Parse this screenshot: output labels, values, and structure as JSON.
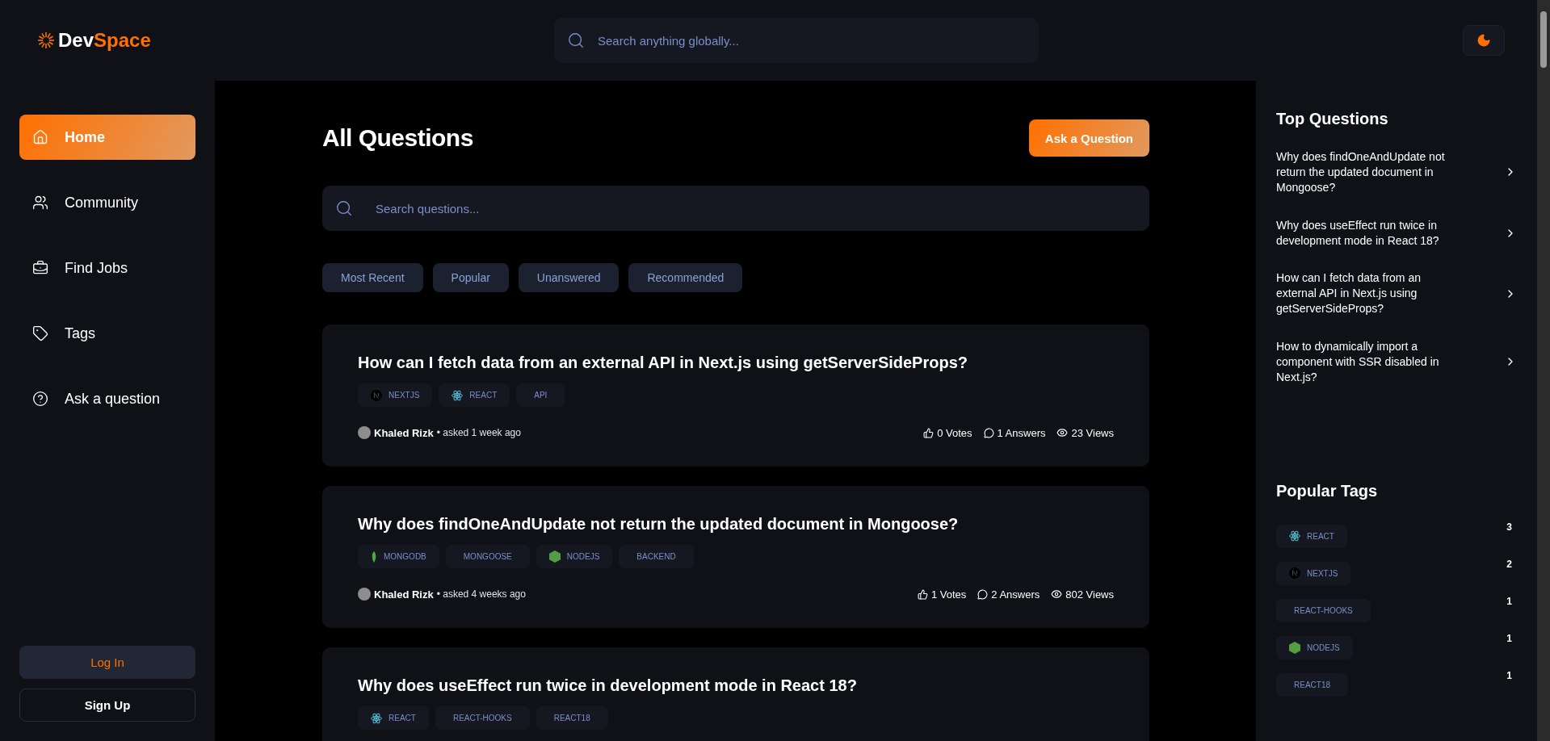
{
  "logo": {
    "part_1": "Dev",
    "part_2": "Space"
  },
  "global_search": {
    "placeholder": "Search anything globally..."
  },
  "sidebar": {
    "items": [
      {
        "label": "Home",
        "selected": true
      },
      {
        "label": "Community",
        "selected": false
      },
      {
        "label": "Find Jobs",
        "selected": false
      },
      {
        "label": "Tags",
        "selected": false
      },
      {
        "label": "Ask a question",
        "selected": false
      }
    ],
    "login": "Log In",
    "signup": "Sign Up"
  },
  "main": {
    "title": "All Questions",
    "ask_button": "Ask a Question",
    "search": {
      "placeholder": "Search questions..."
    },
    "filters": [
      {
        "label": "Most Recent",
        "selected": false
      },
      {
        "label": "Popular",
        "selected": false
      },
      {
        "label": "Unanswered",
        "selected": false
      },
      {
        "label": "Recommended",
        "selected": false
      }
    ],
    "questions": [
      {
        "title": "How can I fetch data from an external API in Next.js using getServerSideProps?",
        "tags": [
          {
            "label": "NEXTJS",
            "kind": "nextjs"
          },
          {
            "label": "REACT",
            "kind": "react"
          },
          {
            "label": "API",
            "kind": "plain"
          }
        ],
        "author": "Khaled Rizk",
        "asked": "• asked 1 week ago",
        "votes": "0 Votes",
        "answers": "1 Answers",
        "views": "23 Views"
      },
      {
        "title": "Why does findOneAndUpdate not return the updated document in Mongoose?",
        "tags": [
          {
            "label": "MONGODB",
            "kind": "leaf"
          },
          {
            "label": "MONGOOSE",
            "kind": "plain"
          },
          {
            "label": "NODEJS",
            "kind": "hex"
          },
          {
            "label": "BACKEND",
            "kind": "plain"
          }
        ],
        "author": "Khaled Rizk",
        "asked": "• asked 4 weeks ago",
        "votes": "1 Votes",
        "answers": "2 Answers",
        "views": "802 Views"
      },
      {
        "title": "Why does useEffect run twice in development mode in React 18?",
        "tags": [
          {
            "label": "REACT",
            "kind": "react"
          },
          {
            "label": "REACT-HOOKS",
            "kind": "plain"
          },
          {
            "label": "REACT18",
            "kind": "plain"
          }
        ]
      }
    ]
  },
  "right": {
    "top_title": "Top Questions",
    "top_questions": [
      "Why does findOneAndUpdate not return the updated document in Mongoose?",
      "Why does useEffect run twice in development mode in React 18?",
      "How can I fetch data from an external API in Next.js using getServerSideProps?",
      "How to dynamically import a component with SSR disabled in Next.js?"
    ],
    "tags_title": "Popular Tags",
    "popular_tags": [
      {
        "label": "REACT",
        "kind": "react",
        "count": "3"
      },
      {
        "label": "NEXTJS",
        "kind": "nextjs",
        "count": "2"
      },
      {
        "label": "REACT-HOOKS",
        "kind": "plain",
        "count": "1"
      },
      {
        "label": "NODEJS",
        "kind": "hex",
        "count": "1"
      },
      {
        "label": "REACT18",
        "kind": "plain",
        "count": "1"
      }
    ]
  }
}
